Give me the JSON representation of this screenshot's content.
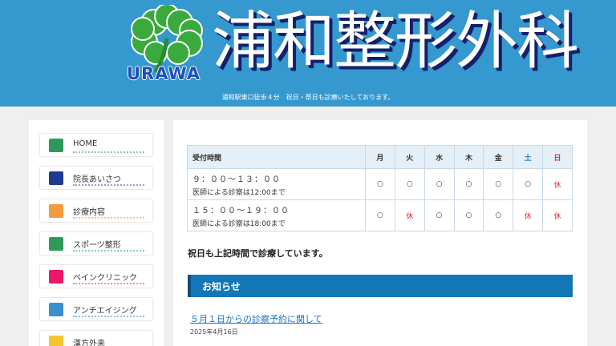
{
  "header": {
    "title": "浦和整形外科",
    "logo_text": "URAWA",
    "tagline": "浦和駅東口徒歩４分　祝日・祭日も診療いたしております。"
  },
  "sidebar": {
    "items": [
      {
        "label": "HOME",
        "color": "#2e9a5a",
        "dots": "#8cc9a4"
      },
      {
        "label": "院長あいさつ",
        "color": "#1f3a8f",
        "dots": "#8fa1d0"
      },
      {
        "label": "診療内容",
        "color": "#f39a3b",
        "dots": "#f6c590"
      },
      {
        "label": "スポーツ整形",
        "color": "#2e9a5a",
        "dots": "#8cc9a4"
      },
      {
        "label": "ペインクリニック",
        "color": "#e9186b",
        "dots": "#f18ab2"
      },
      {
        "label": "アンチエイジング",
        "color": "#3a8fcf",
        "dots": "#90c0e6"
      },
      {
        "label": "漢方外来",
        "color": "#f5c431",
        "dots": "#f8dc86"
      }
    ]
  },
  "hours_table": {
    "header": [
      "受付時間",
      "月",
      "火",
      "水",
      "木",
      "金",
      "土",
      "日"
    ],
    "rows": [
      {
        "time": "９：００～１３：００",
        "note": "医師による診察は12:00まで",
        "cells": [
          "○",
          "○",
          "○",
          "○",
          "○",
          "○",
          "休"
        ]
      },
      {
        "time": "１５：００～１９：００",
        "note": "医師による診察は18:00まで",
        "cells": [
          "○",
          "休",
          "○",
          "○",
          "○",
          "休",
          "休"
        ]
      }
    ]
  },
  "main": {
    "holiday_notice": "祝日も上記時間で診療しています。",
    "news_heading": "お知らせ",
    "news": [
      {
        "title": "５月１日からの診察予約に関して",
        "date": "2025年4月16日"
      }
    ]
  },
  "colors": {
    "header_bg": "#3598cf",
    "news_bar": "#1377b5",
    "saturday": "#2a7fcf",
    "sunday_closed": "#d0303c"
  }
}
